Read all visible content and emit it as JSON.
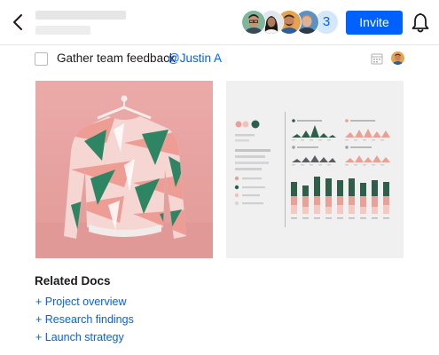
{
  "header": {
    "invite_label": "Invite",
    "collaborator_overflow_count": "3",
    "collaborators": [
      {
        "icon": "avatar-man-glasses"
      },
      {
        "icon": "avatar-woman-dark-hair"
      },
      {
        "icon": "avatar-man-beard"
      },
      {
        "icon": "avatar-man-blond"
      }
    ]
  },
  "task": {
    "checked": false,
    "text": "Gather team feedback",
    "mention": "@Justin A"
  },
  "attachments": [
    {
      "type": "image",
      "icon": "sweater-photo"
    },
    {
      "type": "image",
      "icon": "dashboard-mockup"
    }
  ],
  "related_docs": {
    "title": "Related Docs",
    "links": [
      "+ Project overview",
      "+ Research findings",
      "+ Launch strategy"
    ]
  },
  "colors": {
    "accent": "#0061fe",
    "avatar_count_bg": "#d5e7fb",
    "sweater_bg": "#e8a5a3",
    "chart_green": "#2f5e4b",
    "chart_pink": "#e9a196"
  }
}
